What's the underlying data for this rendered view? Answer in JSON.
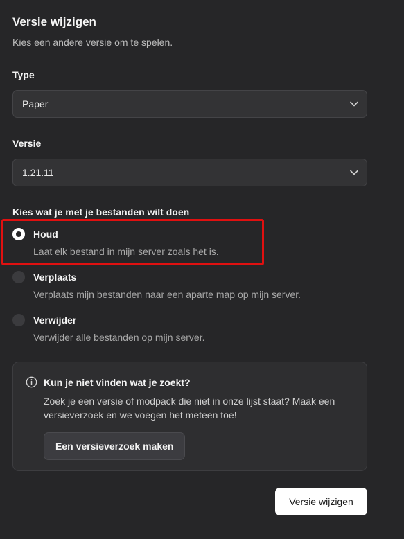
{
  "dialog": {
    "title": "Versie wijzigen",
    "subtitle": "Kies een andere versie om te spelen."
  },
  "type_field": {
    "label": "Type",
    "value": "Paper",
    "icon": "chevron-down-icon"
  },
  "version_field": {
    "label": "Versie",
    "value": "1.21.11",
    "icon": "chevron-down-icon"
  },
  "files": {
    "label": "Kies wat je met je bestanden wilt doen",
    "selected": "Houd",
    "options": [
      {
        "label": "Houd",
        "description": "Laat elk bestand in mijn server zoals het is.",
        "checked": true
      },
      {
        "label": "Verplaats",
        "description": "Verplaats mijn bestanden naar een aparte map op mijn server.",
        "checked": false
      },
      {
        "label": "Verwijder",
        "description": "Verwijder alle bestanden op mijn server.",
        "checked": false
      }
    ]
  },
  "info": {
    "icon": "info-icon",
    "title": "Kun je niet vinden wat je zoekt?",
    "text": "Zoek je een versie of modpack die niet in onze lijst staat? Maak een versieverzoek en we voegen het meteen toe!",
    "button_label": "Een versieverzoek maken"
  },
  "actions": {
    "submit_label": "Versie wijzigen"
  },
  "colors": {
    "background": "#262628",
    "highlight": "#e01010",
    "primary_button": "#ffffff"
  }
}
